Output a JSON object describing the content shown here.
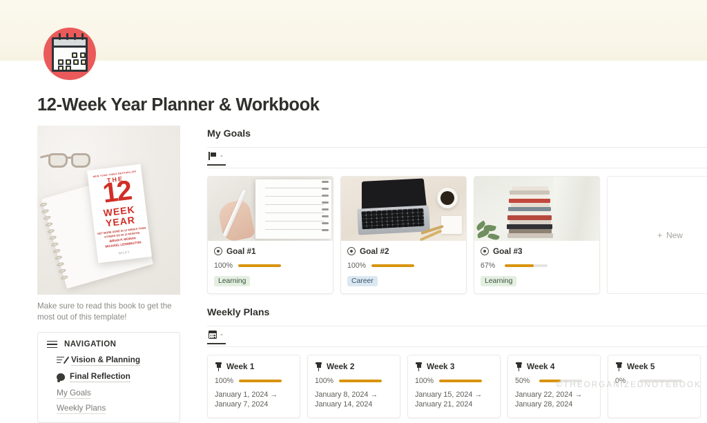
{
  "page": {
    "title": "12-Week Year Planner & Workbook",
    "icon": "calendar-icon",
    "banner_color": "#faf6e9",
    "accent_color": "#ea5a5a"
  },
  "book": {
    "cover": {
      "badge": "NEW YORK TIMES BESTSELLER",
      "the": "THE",
      "number": "12",
      "week": "WEEK",
      "year": "YEAR",
      "subtitle": "GET MORE DONE IN 12 WEEKS THAN OTHERS DO IN 12 MONTHS",
      "author1": "BRIAN P. MORAN",
      "author2": "MICHAEL LENNINGTON",
      "publisher": "WILEY"
    },
    "caption": "Make sure to read this book to get the most out of this template!"
  },
  "navigation": {
    "icon": "hamburger-icon",
    "heading": "NAVIGATION",
    "links": [
      {
        "label": "Vision & Planning",
        "icon": "vision-planning-icon"
      },
      {
        "label": "Final Reflection",
        "icon": "final-reflection-icon"
      }
    ],
    "sub_links": [
      {
        "label": "My Goals"
      },
      {
        "label": "Weekly Plans"
      }
    ]
  },
  "goals_section": {
    "title": "My Goals",
    "view_tab": {
      "icon": "flag-icon",
      "label": "-"
    },
    "new_card": {
      "label": "New",
      "icon": "plus-icon"
    },
    "cards": [
      {
        "name": "Goal #1",
        "icon": "target-icon",
        "progress_pct": "100%",
        "progress_value": 100,
        "tag": "Learning",
        "tag_color": "#e3efe0",
        "thumb": "notebook-planning-photo"
      },
      {
        "name": "Goal #2",
        "icon": "target-icon",
        "progress_pct": "100%",
        "progress_value": 100,
        "tag": "Career",
        "tag_color": "#dbe8f2",
        "thumb": "laptop-desk-photo"
      },
      {
        "name": "Goal #3",
        "icon": "target-icon",
        "progress_pct": "67%",
        "progress_value": 67,
        "tag": "Learning",
        "tag_color": "#e3efe0",
        "thumb": "book-stack-photo"
      }
    ]
  },
  "weekly_section": {
    "title": "Weekly Plans",
    "view_tab": {
      "icon": "calendar-icon",
      "label": "-"
    },
    "cards": [
      {
        "name": "Week 1",
        "icon": "pin-icon",
        "progress_pct": "100%",
        "progress_value": 100,
        "dates": "January 1, 2024 → January 7, 2024"
      },
      {
        "name": "Week 2",
        "icon": "pin-icon",
        "progress_pct": "100%",
        "progress_value": 100,
        "dates": "January 8, 2024 → January 14, 2024"
      },
      {
        "name": "Week 3",
        "icon": "pin-icon",
        "progress_pct": "100%",
        "progress_value": 100,
        "dates": "January 15, 2024 → January 21, 2024"
      },
      {
        "name": "Week 4",
        "icon": "pin-icon",
        "progress_pct": "50%",
        "progress_value": 50,
        "dates": "January 22, 2024 → January 28, 2024"
      },
      {
        "name": "Week 5",
        "icon": "pin-icon",
        "progress_pct": "0%",
        "progress_value": 0,
        "dates": ""
      }
    ]
  },
  "watermark": "©THEORGANIZEDNOTEBOOK"
}
